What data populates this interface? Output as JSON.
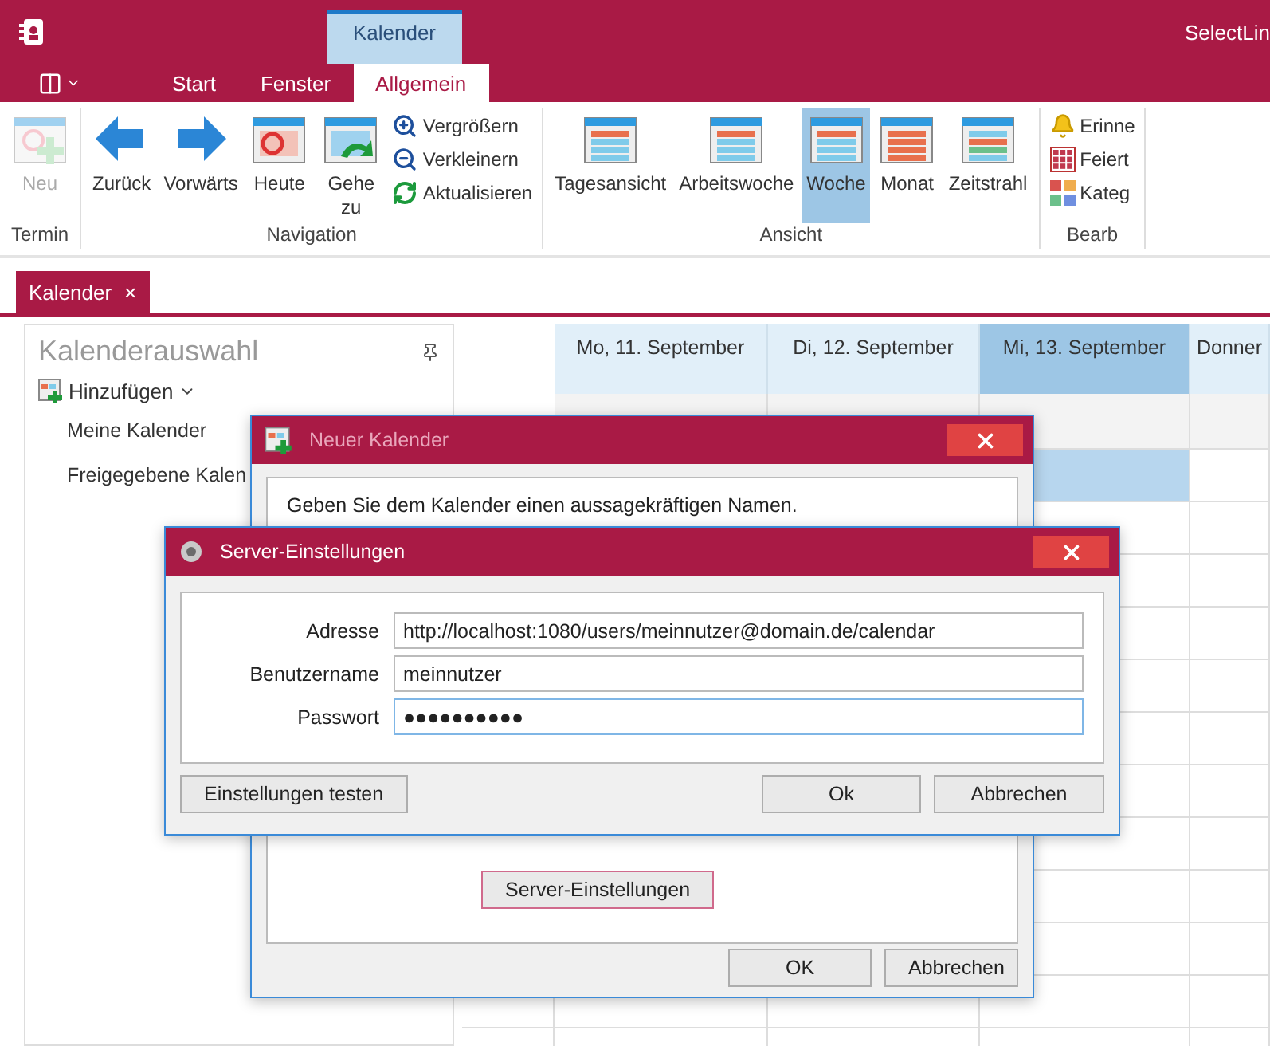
{
  "window": {
    "title": "SelectLin"
  },
  "context_tab": {
    "label": "Kalender"
  },
  "ribbon_tabs": [
    {
      "label": "Start",
      "selected": false
    },
    {
      "label": "Fenster",
      "selected": false
    },
    {
      "label": "Allgemein",
      "selected": true
    }
  ],
  "ribbon_groups": [
    {
      "title": "Termin",
      "large": [
        {
          "kind": "new",
          "label": "Neu",
          "disabled": true,
          "selected": false
        }
      ]
    },
    {
      "title": "Navigation",
      "large": [
        {
          "kind": "back",
          "label": "Zurück",
          "disabled": false,
          "selected": false
        },
        {
          "kind": "forward",
          "label": "Vorwärts",
          "disabled": false,
          "selected": false
        },
        {
          "kind": "today",
          "label": "Heute",
          "disabled": false,
          "selected": false
        },
        {
          "kind": "goto",
          "label": "Gehe zu",
          "disabled": false,
          "selected": false
        }
      ],
      "small": [
        {
          "kind": "zoomin",
          "label": "Vergrößern"
        },
        {
          "kind": "zoomout",
          "label": "Verkleinern"
        },
        {
          "kind": "refresh",
          "label": "Aktualisieren"
        }
      ]
    },
    {
      "title": "Ansicht",
      "large": [
        {
          "kind": "day",
          "label": "Tagesansicht",
          "disabled": false,
          "selected": false
        },
        {
          "kind": "workweek",
          "label": "Arbeitswoche",
          "disabled": false,
          "selected": false
        },
        {
          "kind": "week",
          "label": "Woche",
          "disabled": false,
          "selected": true
        },
        {
          "kind": "month",
          "label": "Monat",
          "disabled": false,
          "selected": false
        },
        {
          "kind": "timeline",
          "label": "Zeitstrahl",
          "disabled": false,
          "selected": false
        }
      ]
    },
    {
      "title": "Bearb",
      "small": [
        {
          "kind": "bell",
          "label": "Erinne"
        },
        {
          "kind": "holidays",
          "label": "Feiert"
        },
        {
          "kind": "categories",
          "label": "Kateg"
        }
      ]
    }
  ],
  "document_tabs": [
    {
      "label": "Kalender",
      "close": "×",
      "selected": true
    }
  ],
  "sidebar": {
    "title": "Kalenderauswahl",
    "add_button": "Hinzufügen",
    "items": [
      "Meine Kalender",
      "Freigegebene Kalen"
    ]
  },
  "calendar": {
    "days": [
      {
        "label": "Mo, 11. September",
        "selected": false
      },
      {
        "label": "Di, 12. September",
        "selected": false
      },
      {
        "label": "Mi, 13. September",
        "selected": true
      },
      {
        "label": "Donner",
        "selected": false
      }
    ]
  },
  "new_calendar_dialog": {
    "title": "Neuer Kalender",
    "prompt": "Geben Sie dem Kalender einen aussagekräftigen Namen.",
    "server_button": "Server-Einstellungen",
    "buttons": [
      "OK",
      "Abbrechen"
    ]
  },
  "server_dialog": {
    "title": "Server-Einstellungen",
    "fields": [
      {
        "label": "Adresse",
        "value": "http://localhost:1080/users/meinnutzer@domain.de/calendar",
        "focused": false
      },
      {
        "label": "Benutzername",
        "value": "meinnutzer",
        "focused": false
      },
      {
        "label": "Passwort",
        "value": "●●●●●●●●●●",
        "focused": true
      }
    ],
    "test_button": "Einstellungen testen",
    "buttons": [
      "Ok",
      "Abbrechen"
    ]
  }
}
